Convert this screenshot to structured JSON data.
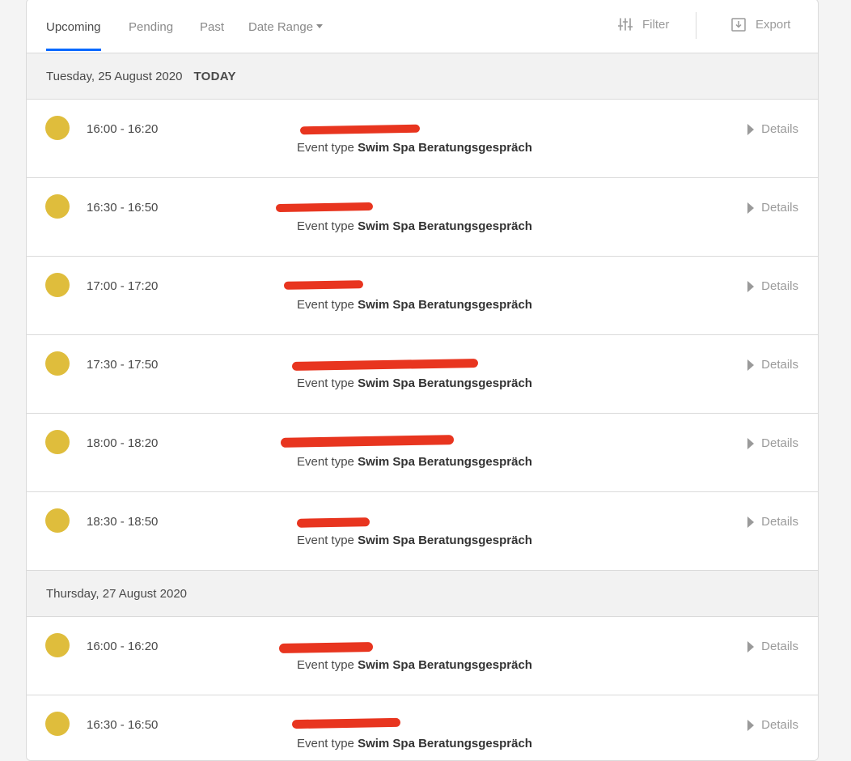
{
  "tabs": [
    {
      "label": "Upcoming"
    },
    {
      "label": "Pending"
    },
    {
      "label": "Past"
    },
    {
      "label": "Date Range"
    }
  ],
  "toolbar": {
    "filter_label": "Filter",
    "export_label": "Export"
  },
  "event_type_prefix": "Event type",
  "details_label": "Details",
  "days": [
    {
      "date": "Tuesday, 25 August 2020",
      "badge": "TODAY",
      "events": [
        {
          "time": "16:00 - 16:20",
          "event_type": "Swim Spa Beratungsgespräch"
        },
        {
          "time": "16:30 - 16:50",
          "event_type": "Swim Spa Beratungsgespräch"
        },
        {
          "time": "17:00 - 17:20",
          "event_type": "Swim Spa Beratungsgespräch"
        },
        {
          "time": "17:30 - 17:50",
          "event_type": "Swim Spa Beratungsgespräch"
        },
        {
          "time": "18:00 - 18:20",
          "event_type": "Swim Spa Beratungsgespräch"
        },
        {
          "time": "18:30 - 18:50",
          "event_type": "Swim Spa Beratungsgespräch"
        }
      ]
    },
    {
      "date": "Thursday, 27 August 2020",
      "badge": "",
      "events": [
        {
          "time": "16:00 - 16:20",
          "event_type": "Swim Spa Beratungsgespräch"
        },
        {
          "time": "16:30 - 16:50",
          "event_type": "Swim Spa Beratungsgespräch"
        }
      ]
    }
  ],
  "colors": {
    "accent": "#0069ff",
    "event_dot": "#dfbd3c",
    "redaction": "#e8351f"
  }
}
